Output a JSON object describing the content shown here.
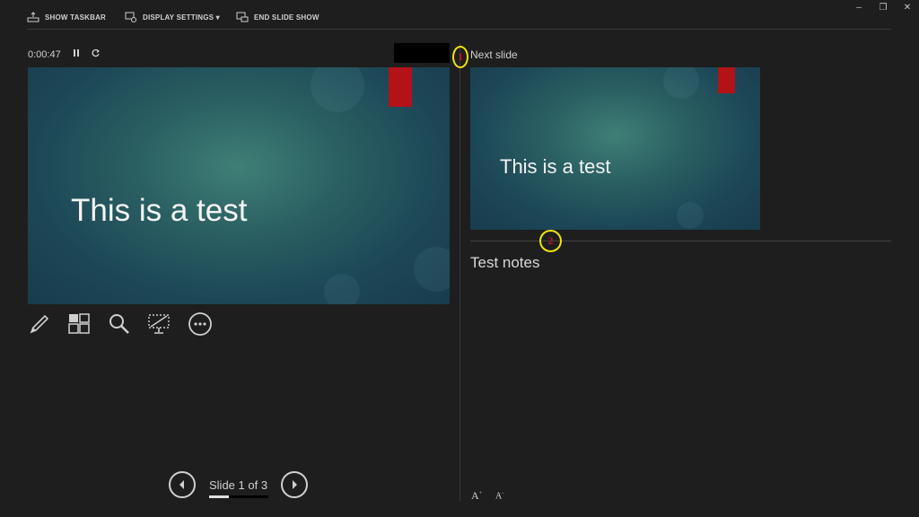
{
  "toolbar": {
    "show_taskbar": "SHOW TASKBAR",
    "display_settings": "DISPLAY SETTINGS ▾",
    "end_slide_show": "END SLIDE SHOW"
  },
  "window": {
    "minimize": "–",
    "restore": "❐",
    "close": "✕"
  },
  "timer": {
    "elapsed": "0:00:47",
    "pause_icon": "pause-icon",
    "reset_icon": "reset-icon"
  },
  "current_slide": {
    "title": "This is a test"
  },
  "next_slide": {
    "label": "Next slide",
    "title": "This is a test"
  },
  "notes": {
    "text": "Test notes"
  },
  "callouts": {
    "one": "1",
    "two": "2"
  },
  "font_controls": {
    "increase": "A",
    "decrease": "A"
  },
  "navigation": {
    "counter": "Slide 1 of 3",
    "current": 1,
    "total": 3
  },
  "colors": {
    "background": "#1e1e1e",
    "slide_accent": "#b31217",
    "callout_ring": "#f0e400",
    "callout_text": "#c8101a"
  }
}
